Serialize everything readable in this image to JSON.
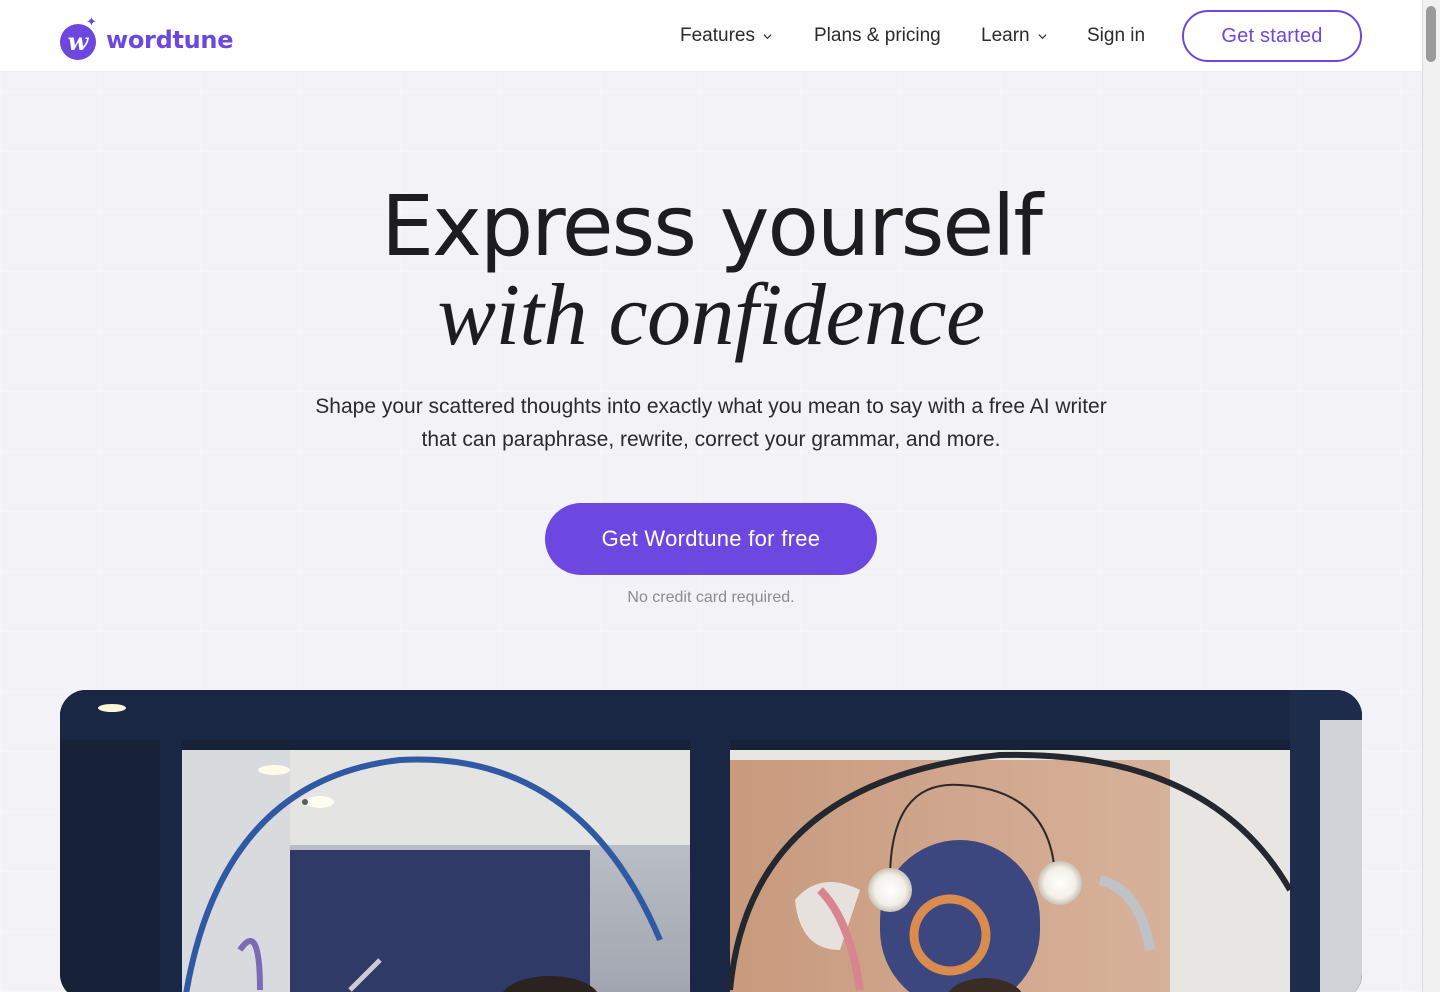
{
  "header": {
    "logo_text": "wordtune",
    "nav": [
      {
        "label": "Features",
        "has_dropdown": true
      },
      {
        "label": "Plans & pricing",
        "has_dropdown": false
      },
      {
        "label": "Learn",
        "has_dropdown": true
      },
      {
        "label": "Sign in",
        "has_dropdown": false
      }
    ],
    "cta_label": "Get started"
  },
  "hero": {
    "title_line1": "Express yourself",
    "title_line2": "with confidence",
    "subtitle": "Shape your scattered thoughts into exactly what you mean to say with a free AI writer that can paraphrase, rewrite, correct your grammar, and more.",
    "cta_label": "Get Wordtune for free",
    "note": "No credit card required."
  },
  "colors": {
    "brand": "#6c47e0",
    "background": "#f3f2f6",
    "text": "#1d1d20",
    "muted": "#8b8b94"
  },
  "icons": [
    "wordtune-logo-icon",
    "chevron-down-icon"
  ]
}
